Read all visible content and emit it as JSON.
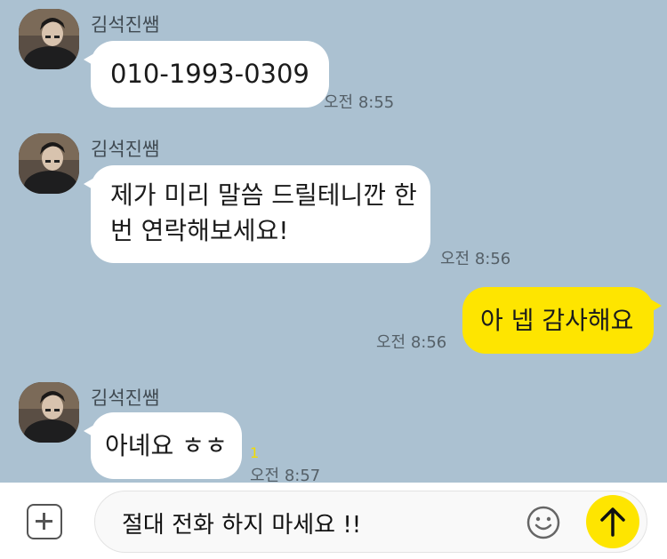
{
  "messages": [
    {
      "sender": "김석진쌤",
      "text": "010-1993-0309",
      "time": "오전 8:55"
    },
    {
      "sender": "김석진쌤",
      "lines": [
        "제가 미리 말씀 드릴테니깐 한",
        "번 연락해보세요!"
      ],
      "time": "오전 8:56"
    },
    {
      "text": "아 넵 감사해요",
      "time": "오전 8:56",
      "mine": true
    },
    {
      "sender": "김석진쌤",
      "text": "아녜요 ㅎㅎ",
      "time": "오전 8:57",
      "unread": "1"
    }
  ],
  "input": {
    "value": "절대 전화 하지 마세요 !!"
  },
  "icons": {
    "attach": "plus-icon",
    "emoji": "emoji-icon",
    "send": "arrow-up-icon",
    "avatar": "profile-photo"
  },
  "colors": {
    "background": "#abc1d1",
    "my_bubble": "#fee500",
    "their_bubble": "#ffffff",
    "unread": "#f2dc00"
  }
}
